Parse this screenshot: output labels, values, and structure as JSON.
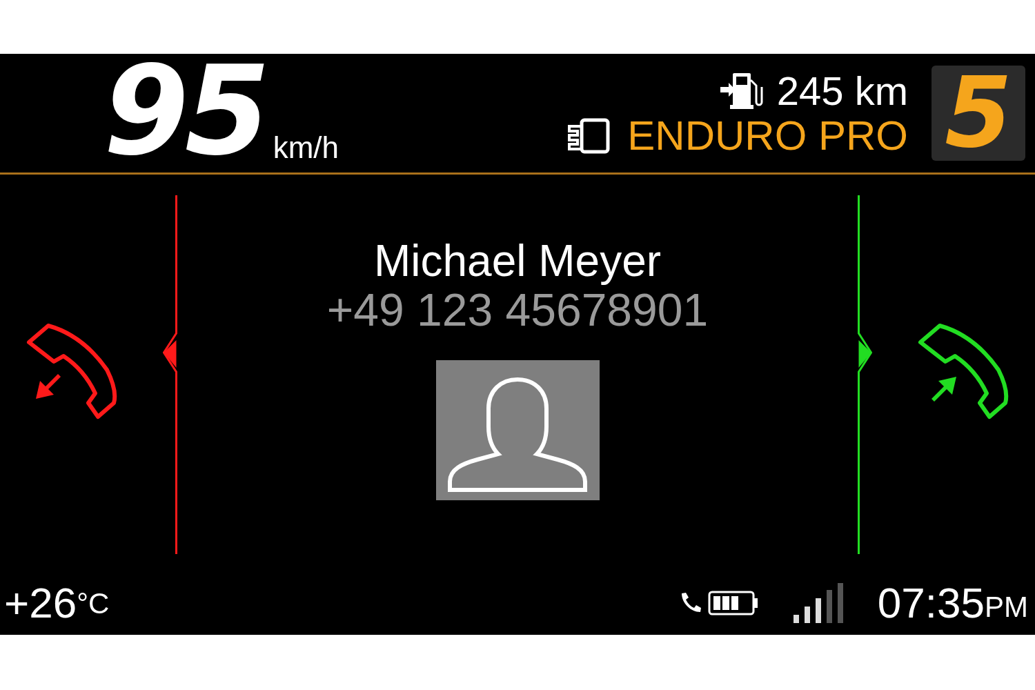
{
  "header": {
    "speed": "95",
    "speed_unit": "km/h",
    "range": "245 km",
    "riding_mode": "ENDURO PRO",
    "gear": "5"
  },
  "call": {
    "name": "Michael Meyer",
    "number": "+49 123 45678901"
  },
  "actions": [
    {
      "kind": "decline",
      "color": "#ff1a1a"
    },
    {
      "kind": "accept",
      "color": "#22dd22"
    }
  ],
  "status_bar": {
    "temperature": "+26",
    "temperature_unit": "°C",
    "time": "07:35",
    "time_suffix": "PM"
  }
}
